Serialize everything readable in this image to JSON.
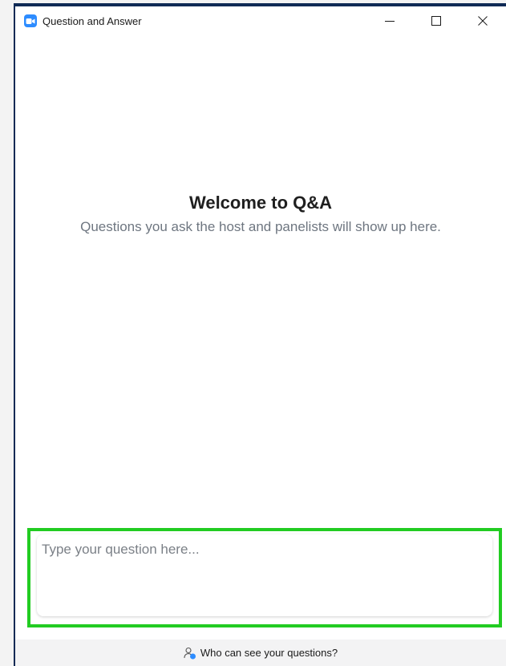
{
  "window": {
    "title": "Question and Answer",
    "app_icon": "zoom-video-icon",
    "controls": [
      "minimize-icon",
      "maximize-icon",
      "close-icon"
    ]
  },
  "welcome": {
    "title": "Welcome to Q&A",
    "subtitle": "Questions you ask the host and panelists will show up here."
  },
  "question_input": {
    "placeholder": "Type your question here...",
    "value": ""
  },
  "footer": {
    "who_can_see_label": "Who can see your questions?",
    "icon": "person-info-icon"
  },
  "colors": {
    "accent": "#2d8cff",
    "highlight_border": "#22cc22",
    "frame": "#0f2a55"
  }
}
